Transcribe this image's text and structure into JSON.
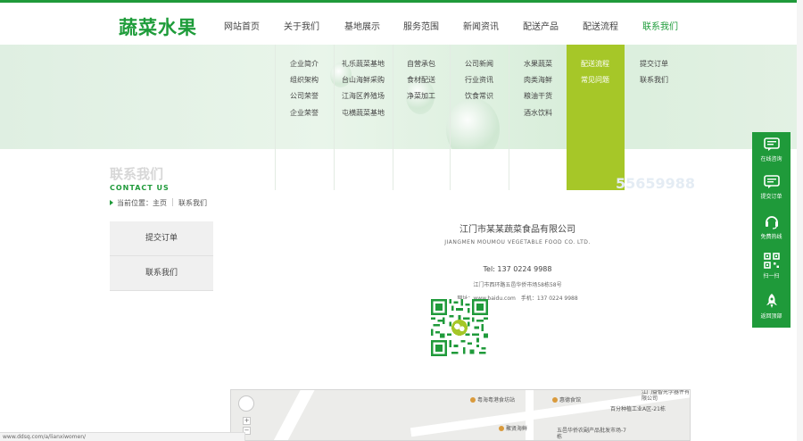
{
  "logo": "蔬菜水果",
  "nav": [
    {
      "label": "网站首页",
      "active": false
    },
    {
      "label": "关于我们",
      "active": false
    },
    {
      "label": "基地展示",
      "active": false
    },
    {
      "label": "服务范围",
      "active": false
    },
    {
      "label": "新闻资讯",
      "active": false
    },
    {
      "label": "配送产品",
      "active": false
    },
    {
      "label": "配送流程",
      "active": false
    },
    {
      "label": "联系我们",
      "active": true
    }
  ],
  "dropdown": {
    "about": [
      "企业简介",
      "组织架构",
      "公司荣誉",
      "企业荣誉"
    ],
    "base": [
      "礼乐蔬菜基地",
      "台山海鲜采购",
      "江海区养殖场",
      "屯横蔬菜基地"
    ],
    "service": [
      "自营承包",
      "食材配送",
      "净菜加工"
    ],
    "news": [
      "公司新闻",
      "行业资讯",
      "饮食常识"
    ],
    "products": [
      "水果蔬菜",
      "肉类海鲜",
      "粮油干货",
      "酒水饮料"
    ],
    "process": [
      "配送流程",
      "常见问题"
    ],
    "contact": [
      "提交订单",
      "联系我们"
    ]
  },
  "page": {
    "title": "联系我们",
    "title_en": "CONTACT US",
    "breadcrumb_prefix": "当前位置：",
    "breadcrumb_home": "主页",
    "breadcrumb_current": "联系我们",
    "phone_faint": "55659988"
  },
  "side_menu": [
    "提交订单",
    "联系我们"
  ],
  "contact": {
    "company": "江门市某某蔬菜食品有限公司",
    "company_en": "JIANGMEN MOUMOU VEGETABLE FOOD CO. LTD.",
    "tel": "Tel: 137 0224 9988",
    "address": "江门市西环路五邑华侨市场58栋58号",
    "web": "网址：www.baidu.com　手机：137 0224 9988"
  },
  "map": {
    "pois": [
      "粤海粤港食坊站",
      "惠德食馆",
      "聚贤海鲜",
      "江门益智光学器件有限公司",
      "百分种植工业A区-21栋",
      "五邑华侨农副产品批发市场-7栋"
    ]
  },
  "status_url": "www.ddsq.com/a/lianxiwomen/",
  "float_bar": [
    "在线咨询",
    "提交订单",
    "免费热线",
    "扫一扫",
    "返回顶部"
  ],
  "colors": {
    "brand_green": "#1f9a3a",
    "highlight": "#a6c728"
  }
}
